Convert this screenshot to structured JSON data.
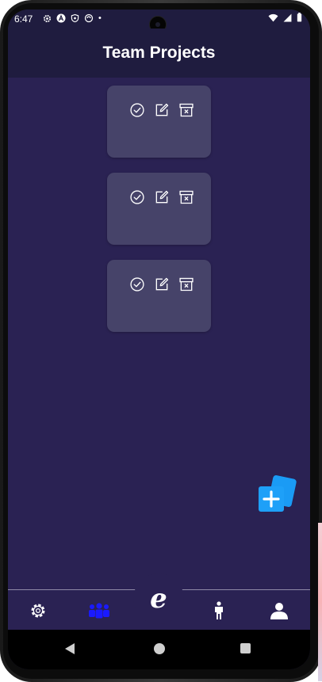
{
  "status_bar": {
    "time": "6:47",
    "dot": "•"
  },
  "header": {
    "title": "Team Projects"
  },
  "projects": [
    {
      "actions": [
        "check-circle-icon",
        "edit-icon",
        "archive-x-icon"
      ]
    },
    {
      "actions": [
        "check-circle-icon",
        "edit-icon",
        "archive-x-icon"
      ]
    },
    {
      "actions": [
        "check-circle-icon",
        "edit-icon",
        "archive-x-icon"
      ]
    }
  ],
  "fab": {
    "icon": "add-project-icon",
    "color": "#1a9bf5"
  },
  "bottom_nav": {
    "items": [
      "settings-icon",
      "team-icon",
      "person-standing-icon",
      "profile-icon"
    ],
    "active_color": "#1a1aff",
    "center_glyph": "e"
  },
  "colors": {
    "background": "#2a2253",
    "header": "#1f1c3f",
    "card": "#464369"
  }
}
